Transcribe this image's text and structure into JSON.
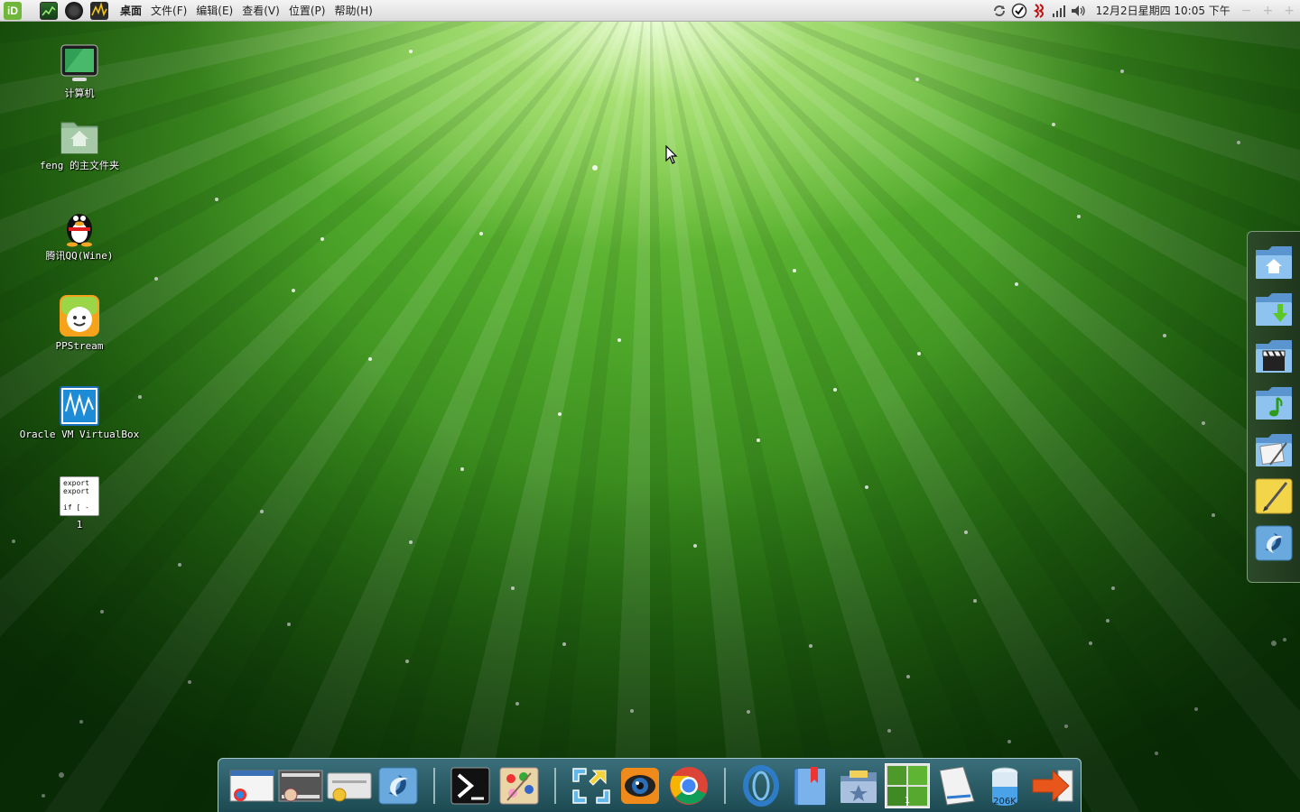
{
  "top_panel": {
    "launchers": [
      {
        "name": "app-logo-icon",
        "glyph": "iD"
      },
      {
        "name": "system-monitor-icon",
        "glyph": ""
      },
      {
        "name": "chrome-launcher-icon",
        "glyph": ""
      },
      {
        "name": "screenshot-tool-icon",
        "glyph": ""
      }
    ],
    "menus": [
      "桌面",
      "文件(F)",
      "编辑(E)",
      "查看(V)",
      "位置(P)",
      "帮助(H)"
    ],
    "tray_icons": [
      "refresh-icon",
      "checkmark-icon",
      "input-method-icon",
      "signal-icon",
      "volume-icon"
    ],
    "clock": "12月2日星期四 10:05 下午",
    "window_controls": [
      "−",
      "+",
      "+"
    ]
  },
  "desktop_icons": [
    {
      "label": "计算机",
      "icon": "computer-icon"
    },
    {
      "label": "feng 的主文件夹",
      "icon": "home-folder-icon"
    },
    {
      "label": "腾讯QQ(Wine)",
      "icon": "qq-penguin-icon"
    },
    {
      "label": "PPStream",
      "icon": "ppstream-icon"
    },
    {
      "label": "Oracle VM VirtualBox",
      "icon": "virtualbox-icon"
    },
    {
      "label": "1",
      "icon": "script-file-icon",
      "preview": [
        "export",
        "export",
        "",
        "if [ -"
      ]
    }
  ],
  "drawer_items": [
    "home-folder-icon",
    "downloads-folder-icon",
    "video-folder-icon",
    "music-folder-icon",
    "documents-folder-icon",
    "notes-icon",
    "swirl-app-icon"
  ],
  "dock_items": [
    {
      "name": "browser-window-icon"
    },
    {
      "name": "video-editor-icon"
    },
    {
      "name": "cd-burner-icon"
    },
    {
      "name": "swirl-app-icon"
    },
    {
      "name": "terminal-icon"
    },
    {
      "name": "paint-icon"
    },
    {
      "name": "fullscreen-icon"
    },
    {
      "name": "webcam-icon"
    },
    {
      "name": "chrome-icon"
    },
    {
      "name": "opera-icon"
    },
    {
      "name": "bookmarks-book-icon"
    },
    {
      "name": "favorites-folder-icon"
    },
    {
      "name": "workspace-switcher-icon",
      "badge": "1"
    },
    {
      "name": "text-editor-icon"
    },
    {
      "name": "memory-monitor-icon",
      "badge": "206K"
    },
    {
      "name": "logout-arrow-icon"
    }
  ]
}
